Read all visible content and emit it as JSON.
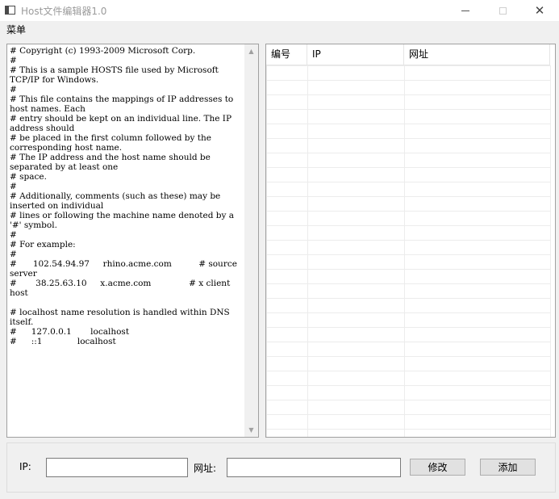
{
  "window": {
    "title": "Host文件编辑器1.0",
    "close_glyph": "✕"
  },
  "menu": {
    "items": [
      {
        "label": "菜单"
      }
    ]
  },
  "hosts_text": "# Copyright (c) 1993-2009 Microsoft Corp.\n#\n# This is a sample HOSTS file used by Microsoft TCP/IP for Windows.\n#\n# This file contains the mappings of IP addresses to host names. Each\n# entry should be kept on an individual line. The IP address should\n# be placed in the first column followed by the corresponding host name.\n# The IP address and the host name should be separated by at least one\n# space.\n#\n# Additionally, comments (such as these) may be inserted on individual\n# lines or following the machine name denoted by a '#' symbol.\n#\n# For example:\n#\n#      102.54.94.97     rhino.acme.com          # source server\n#       38.25.63.10     x.acme.com              # x client host\n\n# localhost name resolution is handled within DNS itself.\n#\t127.0.0.1       localhost\n#\t::1             localhost",
  "table": {
    "columns": [
      {
        "label": "编号"
      },
      {
        "label": "IP"
      },
      {
        "label": "网址"
      }
    ],
    "rows": []
  },
  "form": {
    "ip_label": "IP:",
    "ip_value": "",
    "url_label": "网址:",
    "url_value": "",
    "edit_button": "修改",
    "add_button": "添加"
  },
  "icons": {
    "app": "app-window-icon",
    "minimize": "minimize-icon",
    "maximize": "maximize-icon",
    "close": "close-icon",
    "scroll_up": "chevron-up-icon",
    "scroll_down": "chevron-down-icon"
  }
}
